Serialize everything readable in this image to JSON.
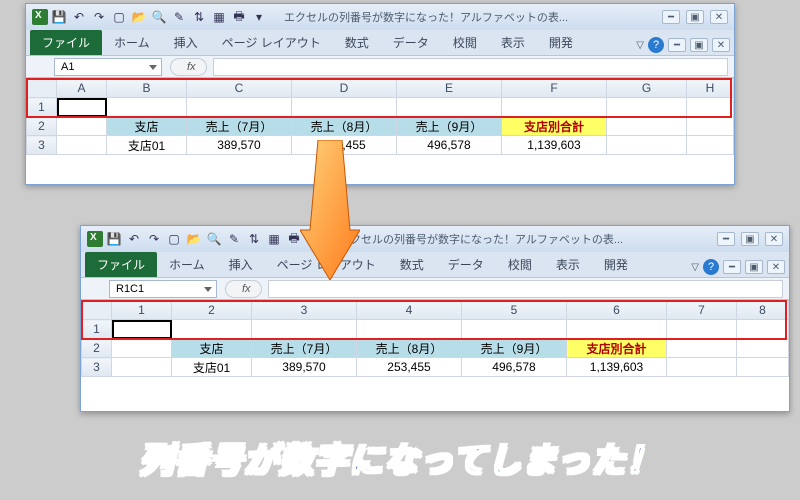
{
  "window_title": "エクセルの列番号が数字になった！アルファベットの表...",
  "ribbon": {
    "file": "ファイル",
    "tabs": [
      "ホーム",
      "挿入",
      "ページ レイアウト",
      "数式",
      "データ",
      "校閲",
      "表示",
      "開発"
    ]
  },
  "top": {
    "namebox": "A1",
    "columns": [
      "A",
      "B",
      "C",
      "D",
      "E",
      "F",
      "G",
      "H"
    ],
    "rows": [
      "1",
      "2",
      "3"
    ],
    "table_headers": [
      "支店",
      "売上（7月）",
      "売上（8月）",
      "売上（9月）",
      "支店別合計"
    ],
    "data_row": [
      "支店01",
      "389,570",
      "253,455",
      "496,578",
      "1,139,603"
    ]
  },
  "bottom": {
    "namebox": "R1C1",
    "columns": [
      "1",
      "2",
      "3",
      "4",
      "5",
      "6",
      "7",
      "8"
    ],
    "rows": [
      "1",
      "2",
      "3"
    ],
    "table_headers": [
      "支店",
      "売上（7月）",
      "売上（8月）",
      "売上（9月）",
      "支店別合計"
    ],
    "data_row": [
      "支店01",
      "389,570",
      "253,455",
      "496,578",
      "1,139,603"
    ]
  },
  "fx_label": "fx",
  "caption": "列番号が数字になってしまった！"
}
